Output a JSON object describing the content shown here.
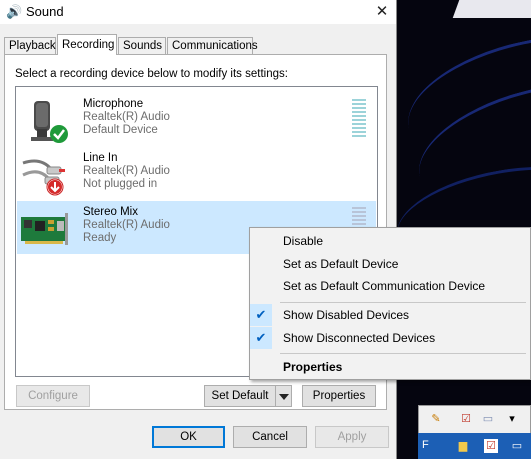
{
  "window": {
    "title": "Sound",
    "close_symbol": "✕"
  },
  "tabs": [
    {
      "label": "Playback",
      "active": false
    },
    {
      "label": "Recording",
      "active": true
    },
    {
      "label": "Sounds",
      "active": false
    },
    {
      "label": "Communications",
      "active": false
    }
  ],
  "instruction": "Select a recording device below to modify its settings:",
  "devices": [
    {
      "name": "Microphone",
      "driver": "Realtek(R) Audio",
      "state": "Default Device",
      "status_icon": "green-check-icon",
      "selected": false
    },
    {
      "name": "Line In",
      "driver": "Realtek(R) Audio",
      "state": "Not plugged in",
      "status_icon": "red-down-arrow-icon",
      "selected": false
    },
    {
      "name": "Stereo Mix",
      "driver": "Realtek(R) Audio",
      "state": "Ready",
      "status_icon": "",
      "selected": true
    }
  ],
  "buttons": {
    "configure": "Configure",
    "set_default": "Set Default",
    "properties": "Properties",
    "ok": "OK",
    "cancel": "Cancel",
    "apply": "Apply"
  },
  "context_menu": {
    "items": [
      {
        "label": "Disable",
        "checked": false,
        "bold": false
      },
      {
        "label": "Set as Default Device",
        "checked": false,
        "bold": false
      },
      {
        "label": "Set as Default Communication Device",
        "checked": false,
        "bold": false
      },
      {
        "label": "Show Disabled Devices",
        "checked": true,
        "bold": false
      },
      {
        "label": "Show Disconnected Devices",
        "checked": true,
        "bold": false
      },
      {
        "label": "Properties",
        "checked": false,
        "bold": true
      }
    ]
  },
  "taskbar": {
    "letter": "F"
  },
  "colors": {
    "selection": "#cce8ff",
    "accent": "#0078d7",
    "check": "#0060c0"
  }
}
